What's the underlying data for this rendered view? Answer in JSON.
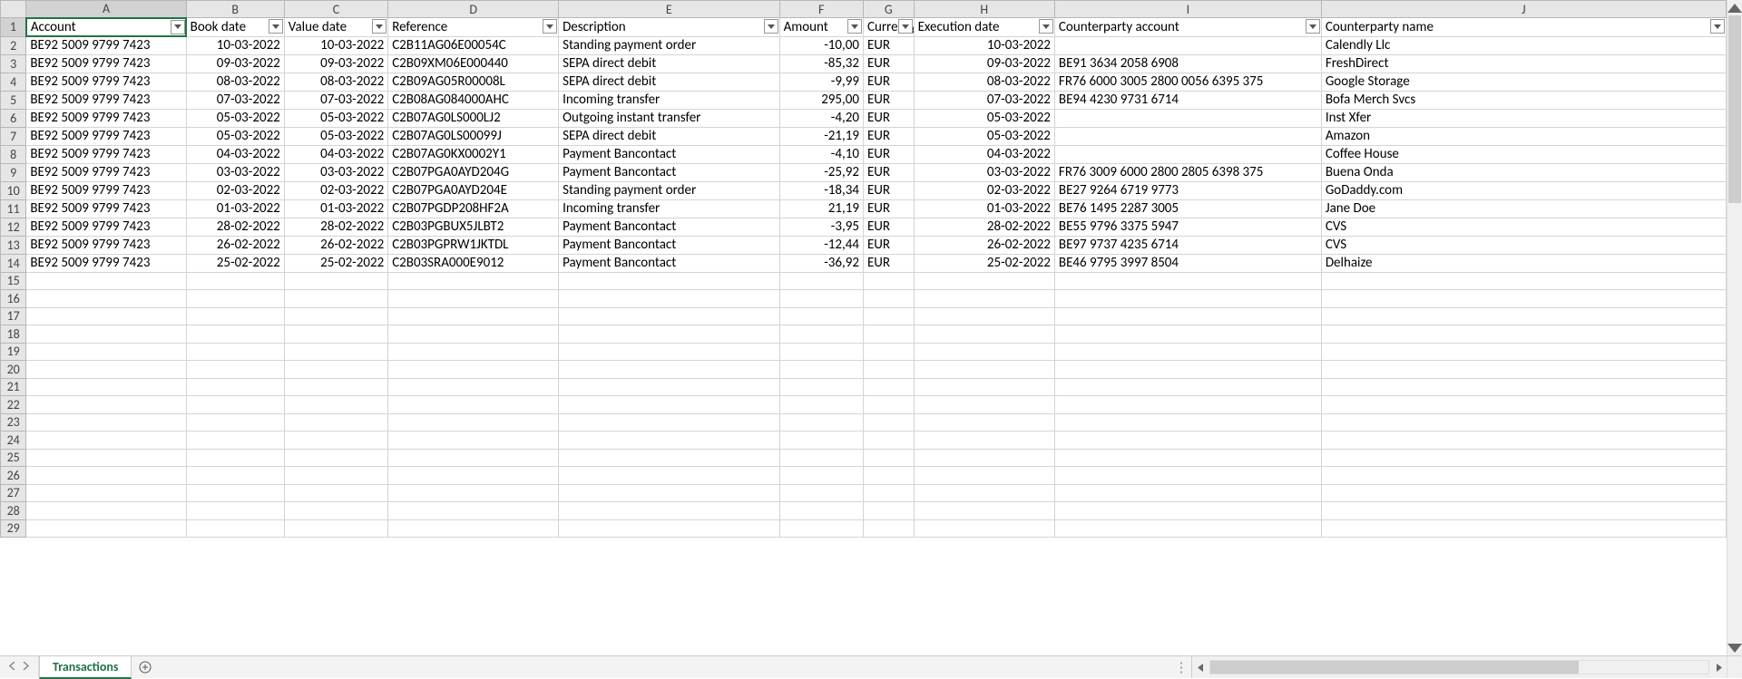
{
  "columns": [
    "A",
    "B",
    "C",
    "D",
    "E",
    "F",
    "G",
    "H",
    "I",
    "J"
  ],
  "headerRow": {
    "A": "Account",
    "B": "Book date",
    "C": "Value date",
    "D": "Reference",
    "E": "Description",
    "F": "Amount",
    "G": "Currency",
    "H": "Execution date",
    "I": "Counterparty account",
    "J": "Counterparty name"
  },
  "rows": [
    {
      "A": "BE92 5009 9799 7423",
      "B": "10-03-2022",
      "C": "10-03-2022",
      "D": "C2B11AG06E00054C",
      "E": "Standing payment order",
      "F": "-10,00",
      "G": "EUR",
      "H": "10-03-2022",
      "I": "",
      "J": "Calendly Llc"
    },
    {
      "A": "BE92 5009 9799 7423",
      "B": "09-03-2022",
      "C": "09-03-2022",
      "D": "C2B09XM06E000440",
      "E": "SEPA direct debit",
      "F": "-85,32",
      "G": "EUR",
      "H": "09-03-2022",
      "I": "BE91 3634 2058 6908",
      "J": "FreshDirect"
    },
    {
      "A": "BE92 5009 9799 7423",
      "B": "08-03-2022",
      "C": "08-03-2022",
      "D": "C2B09AG05R00008L",
      "E": "SEPA direct debit",
      "F": "-9,99",
      "G": "EUR",
      "H": "08-03-2022",
      "I": "FR76 6000 3005 2800 0056 6395 375",
      "J": "Google Storage"
    },
    {
      "A": "BE92 5009 9799 7423",
      "B": "07-03-2022",
      "C": "07-03-2022",
      "D": "C2B08AG084000AHC",
      "E": "Incoming transfer",
      "F": "295,00",
      "G": "EUR",
      "H": "07-03-2022",
      "I": "BE94 4230 9731 6714",
      "J": "Bofa Merch Svcs"
    },
    {
      "A": "BE92 5009 9799 7423",
      "B": "05-03-2022",
      "C": "05-03-2022",
      "D": "C2B07AG0LS000LJ2",
      "E": "Outgoing instant transfer",
      "F": "-4,20",
      "G": "EUR",
      "H": "05-03-2022",
      "I": "",
      "J": "Inst Xfer"
    },
    {
      "A": "BE92 5009 9799 7423",
      "B": "05-03-2022",
      "C": "05-03-2022",
      "D": "C2B07AG0LS00099J",
      "E": "SEPA direct debit",
      "F": "-21,19",
      "G": "EUR",
      "H": "05-03-2022",
      "I": "",
      "J": "Amazon"
    },
    {
      "A": "BE92 5009 9799 7423",
      "B": "04-03-2022",
      "C": "04-03-2022",
      "D": "C2B07AG0KX0002Y1",
      "E": "Payment Bancontact",
      "F": "-4,10",
      "G": "EUR",
      "H": "04-03-2022",
      "I": "",
      "J": "Coffee House"
    },
    {
      "A": "BE92 5009 9799 7423",
      "B": "03-03-2022",
      "C": "03-03-2022",
      "D": "C2B07PGA0AYD204G",
      "E": "Payment Bancontact",
      "F": "-25,92",
      "G": "EUR",
      "H": "03-03-2022",
      "I": "FR76 3009 6000 2800 2805 6398 375",
      "J": "Buena Onda"
    },
    {
      "A": "BE92 5009 9799 7423",
      "B": "02-03-2022",
      "C": "02-03-2022",
      "D": "C2B07PGA0AYD204E",
      "E": "Standing payment order",
      "F": "-18,34",
      "G": "EUR",
      "H": "02-03-2022",
      "I": "BE27 9264 6719 9773",
      "J": "GoDaddy.com"
    },
    {
      "A": "BE92 5009 9799 7423",
      "B": "01-03-2022",
      "C": "01-03-2022",
      "D": "C2B07PGDP208HF2A",
      "E": "Incoming transfer",
      "F": "21,19",
      "G": "EUR",
      "H": "01-03-2022",
      "I": "BE76 1495 2287 3005",
      "J": "Jane Doe"
    },
    {
      "A": "BE92 5009 9799 7423",
      "B": "28-02-2022",
      "C": "28-02-2022",
      "D": "C2B03PGBUX5JLBT2",
      "E": "Payment Bancontact",
      "F": "-3,95",
      "G": "EUR",
      "H": "28-02-2022",
      "I": "BE55 9796 3375 5947",
      "J": "CVS"
    },
    {
      "A": "BE92 5009 9799 7423",
      "B": "26-02-2022",
      "C": "26-02-2022",
      "D": "C2B03PGPRW1JKTDL",
      "E": "Payment Bancontact",
      "F": "-12,44",
      "G": "EUR",
      "H": "26-02-2022",
      "I": "BE97 9737 4235 6714",
      "J": "CVS"
    },
    {
      "A": "BE92 5009 9799 7423",
      "B": "25-02-2022",
      "C": "25-02-2022",
      "D": "C2B03SRA000E9012",
      "E": "Payment Bancontact",
      "F": "-36,92",
      "G": "EUR",
      "H": "25-02-2022",
      "I": "BE46 9795 3997 8504",
      "J": "Delhaize"
    }
  ],
  "emptyRowStart": 15,
  "emptyRowEnd": 29,
  "activeCell": "A1",
  "sheetTab": "Transactions"
}
